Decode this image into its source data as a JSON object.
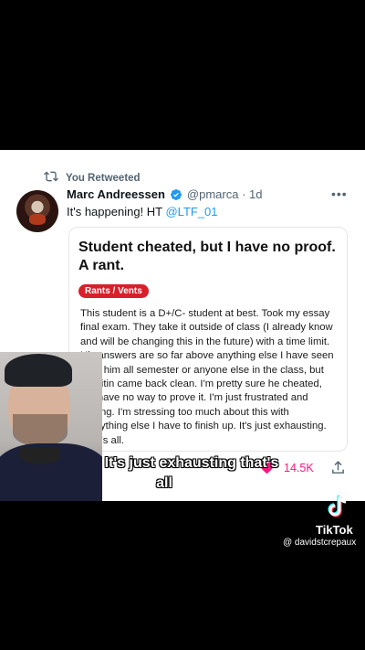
{
  "retweet": {
    "label": "You Retweeted"
  },
  "tweet": {
    "author_name": "Marc Andreessen",
    "handle_time": "@pmarca · 1d",
    "text_prefix": "It's happening! HT ",
    "mention": "@LTF_01"
  },
  "embedded_post": {
    "title": "Student cheated, but I have no proof. A rant.",
    "flair": "Rants / Vents",
    "body": "This student is a D+/C- student at best. Took my essay final exam. They take it outside of class (I already know and will be changing this in the future) with a time limit. His answers are so far above anything else I have seen from him all semester or anyone else in the class, but Turnitin came back clean. I'm pretty sure he cheated, but have no way to prove it. I'm just frustrated and ranting. I'm stressing too much about this with everything else I have to finish up. It's just exhausting. That's all."
  },
  "stats": {
    "likes": "14.5K"
  },
  "caption": {
    "line1": "It's just exhausting that's",
    "line2": "all"
  },
  "watermark": {
    "brand": "TikTok",
    "username": "@ davidstcrepaux"
  },
  "colors": {
    "link": "#1d9bf0",
    "heart": "#f91880",
    "flair": "#d8202a",
    "verified": "#1d9bf0"
  }
}
